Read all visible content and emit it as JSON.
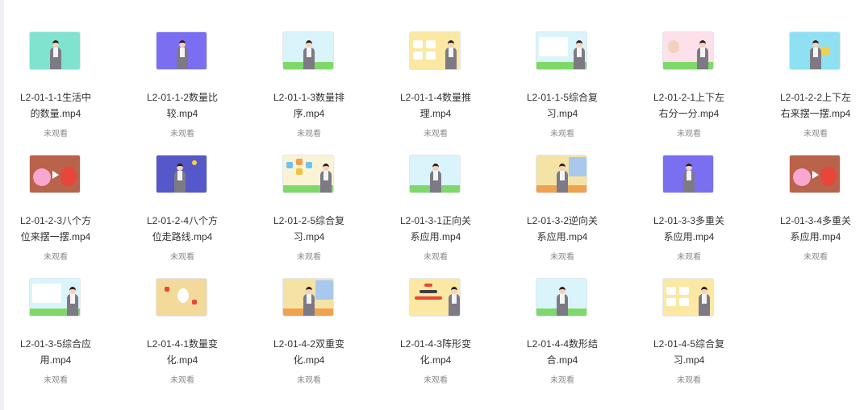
{
  "colors": {
    "title_text": "#333333",
    "status_text": "#8a8a8a"
  },
  "videos": [
    {
      "title": "L2-01-1-1生活中的数量.mp4",
      "status": "未观看",
      "thumbnail_icon": "teacher-mint-icon"
    },
    {
      "title": "L2-01-1-2数量比较.mp4",
      "status": "未观看",
      "thumbnail_icon": "teacher-purple-icon"
    },
    {
      "title": "L2-01-1-3数量排序.mp4",
      "status": "未观看",
      "thumbnail_icon": "teacher-sky-icon"
    },
    {
      "title": "L2-01-1-4数量推理.mp4",
      "status": "未观看",
      "thumbnail_icon": "teacher-puzzle-icon"
    },
    {
      "title": "L2-01-1-5综合复习.mp4",
      "status": "未观看",
      "thumbnail_icon": "teacher-board-icon"
    },
    {
      "title": "L2-01-2-1上下左右分一分.mp4",
      "status": "未观看",
      "thumbnail_icon": "teacher-cartoon-pink-icon"
    },
    {
      "title": "L2-01-2-2上下左右来摆一摆.mp4",
      "status": "未观看",
      "thumbnail_icon": "teacher-blue-icon"
    },
    {
      "title": "L2-01-2-3八个方位来摆一摆.mp4",
      "status": "未观看",
      "thumbnail_icon": "cartoon-characters-icon"
    },
    {
      "title": "L2-01-2-4八个方位走路线.mp4",
      "status": "未观看",
      "thumbnail_icon": "teacher-indigo-icon"
    },
    {
      "title": "L2-01-2-5综合复习.mp4",
      "status": "未观看",
      "thumbnail_icon": "teacher-diagram-icon"
    },
    {
      "title": "L2-01-3-1正向关系应用.mp4",
      "status": "未观看",
      "thumbnail_icon": "teacher-sky-icon"
    },
    {
      "title": "L2-01-3-2逆向关系应用.mp4",
      "status": "未观看",
      "thumbnail_icon": "teacher-window-icon"
    },
    {
      "title": "L2-01-3-3多重关系应用.mp4",
      "status": "未观看",
      "thumbnail_icon": "teacher-purple-icon"
    },
    {
      "title": "L2-01-3-4多重关系应用.mp4",
      "status": "未观看",
      "thumbnail_icon": "cartoon-characters-icon"
    },
    {
      "title": "L2-01-3-5综合应用.mp4",
      "status": "未观看",
      "thumbnail_icon": "teacher-board-icon"
    },
    {
      "title": "L2-01-4-1数量变化.mp4",
      "status": "未观看",
      "thumbnail_icon": "game-board-icon"
    },
    {
      "title": "L2-01-4-2双重变化.mp4",
      "status": "未观看",
      "thumbnail_icon": "teacher-window-icon"
    },
    {
      "title": "L2-01-4-3阵形变化.mp4",
      "status": "未观看",
      "thumbnail_icon": "pyramid-pattern-icon"
    },
    {
      "title": "L2-01-4-4数形结合.mp4",
      "status": "未观看",
      "thumbnail_icon": "teacher-sky-icon"
    },
    {
      "title": "L2-01-4-5综合复习.mp4",
      "status": "未观看",
      "thumbnail_icon": "teacher-puzzle-icon"
    }
  ]
}
